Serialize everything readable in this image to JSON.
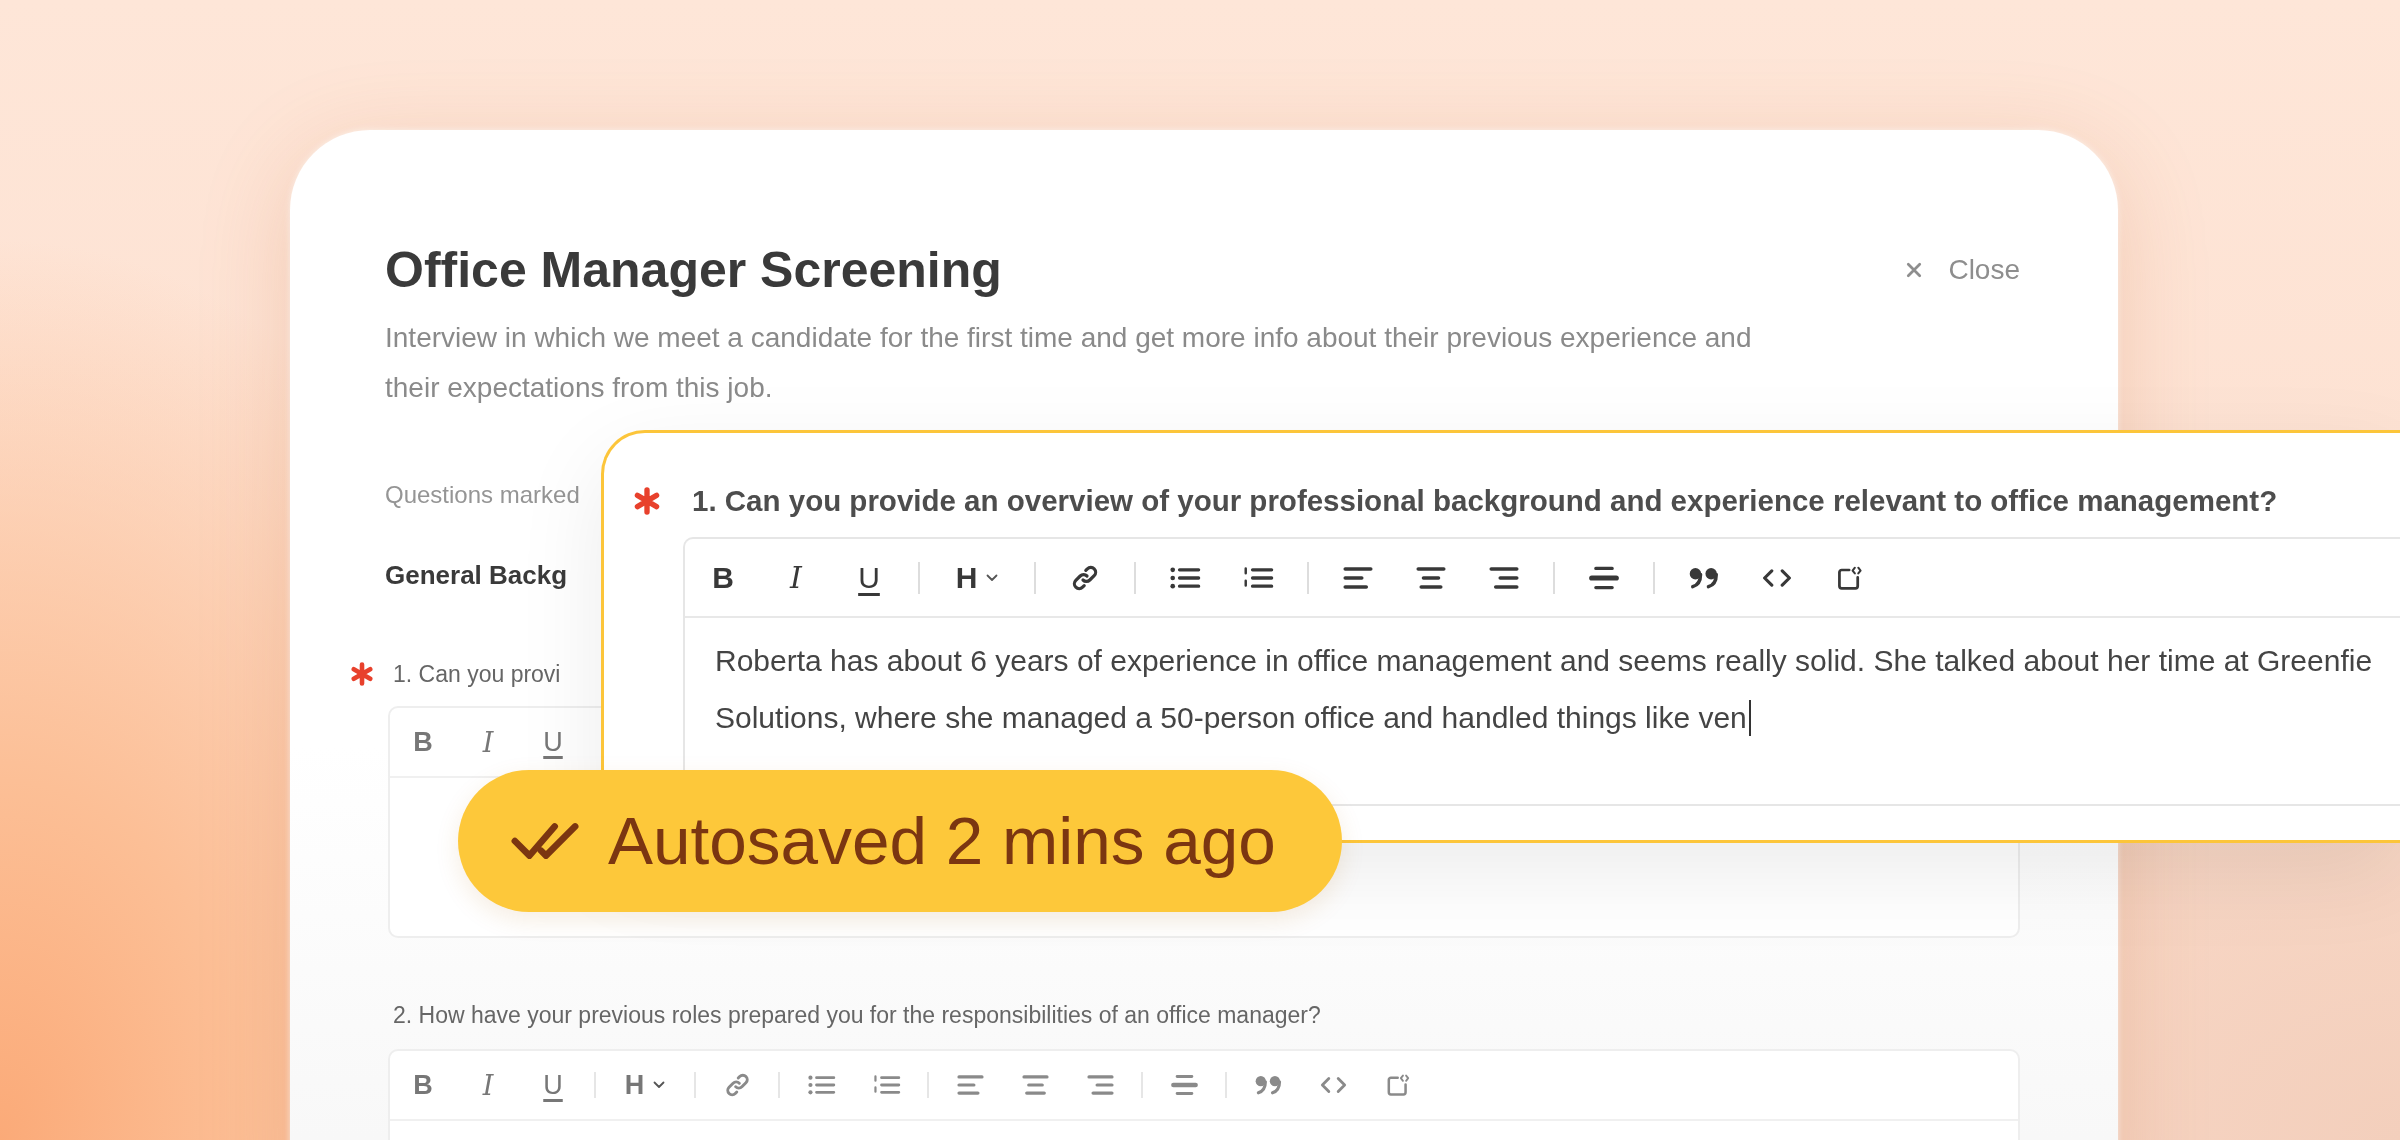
{
  "backdrop_form": {
    "title": "Office Manager Screening",
    "close_button": {
      "label": "Close"
    },
    "description": "Interview in which we meet a candidate for the first time and get more info about their previous experience and their expectations from this job.",
    "note": "Questions marked",
    "section_title": "General Backg",
    "questions": [
      {
        "text": "1. Can you provi",
        "required": true,
        "toolbar": [
          {
            "tools": [
              {
                "kind": "bold",
                "label": "B"
              },
              {
                "kind": "italic",
                "label": "I"
              },
              {
                "kind": "underline",
                "label": "U"
              }
            ]
          }
        ]
      },
      {
        "text": "2. How have your previous roles prepared you for the responsibilities of an office manager?",
        "required": false,
        "toolbar": [
          {
            "tools": [
              {
                "kind": "bold",
                "label": "B"
              },
              {
                "kind": "italic",
                "label": "I"
              },
              {
                "kind": "underline",
                "label": "U"
              }
            ]
          },
          {
            "tools": [
              {
                "kind": "heading",
                "label": "H"
              }
            ]
          },
          {
            "tools": [
              {
                "kind": "link"
              }
            ]
          },
          {
            "tools": [
              {
                "kind": "bullet_list"
              },
              {
                "kind": "numbered_list"
              }
            ]
          },
          {
            "tools": [
              {
                "kind": "align_left"
              },
              {
                "kind": "align_center"
              },
              {
                "kind": "align_right"
              }
            ]
          },
          {
            "tools": [
              {
                "kind": "horizontal_rule"
              }
            ]
          },
          {
            "tools": [
              {
                "kind": "quote"
              },
              {
                "kind": "code"
              },
              {
                "kind": "embed"
              }
            ]
          }
        ]
      }
    ]
  },
  "focused_question": {
    "text": "1. Can you provide an overview of your professional background and experience relevant to office management?",
    "required": true,
    "toolbar": [
      {
        "tools": [
          {
            "kind": "bold",
            "label": "B"
          },
          {
            "kind": "italic",
            "label": "I"
          },
          {
            "kind": "underline",
            "label": "U"
          }
        ]
      },
      {
        "tools": [
          {
            "kind": "heading",
            "label": "H"
          }
        ]
      },
      {
        "tools": [
          {
            "kind": "link"
          }
        ]
      },
      {
        "tools": [
          {
            "kind": "bullet_list"
          },
          {
            "kind": "numbered_list"
          }
        ]
      },
      {
        "tools": [
          {
            "kind": "align_left"
          },
          {
            "kind": "align_center"
          },
          {
            "kind": "align_right"
          }
        ]
      },
      {
        "tools": [
          {
            "kind": "horizontal_rule"
          }
        ]
      },
      {
        "tools": [
          {
            "kind": "quote"
          },
          {
            "kind": "code"
          },
          {
            "kind": "embed"
          }
        ]
      }
    ],
    "answer_lines": [
      "Roberta has about 6 years of experience in office management and seems really solid. She talked about her time at Greenfie",
      "Solutions, where she managed a 50-person office and handled things like ven"
    ],
    "cursor": true
  },
  "autosave_badge": {
    "label": "Autosaved 2 mins ago"
  }
}
